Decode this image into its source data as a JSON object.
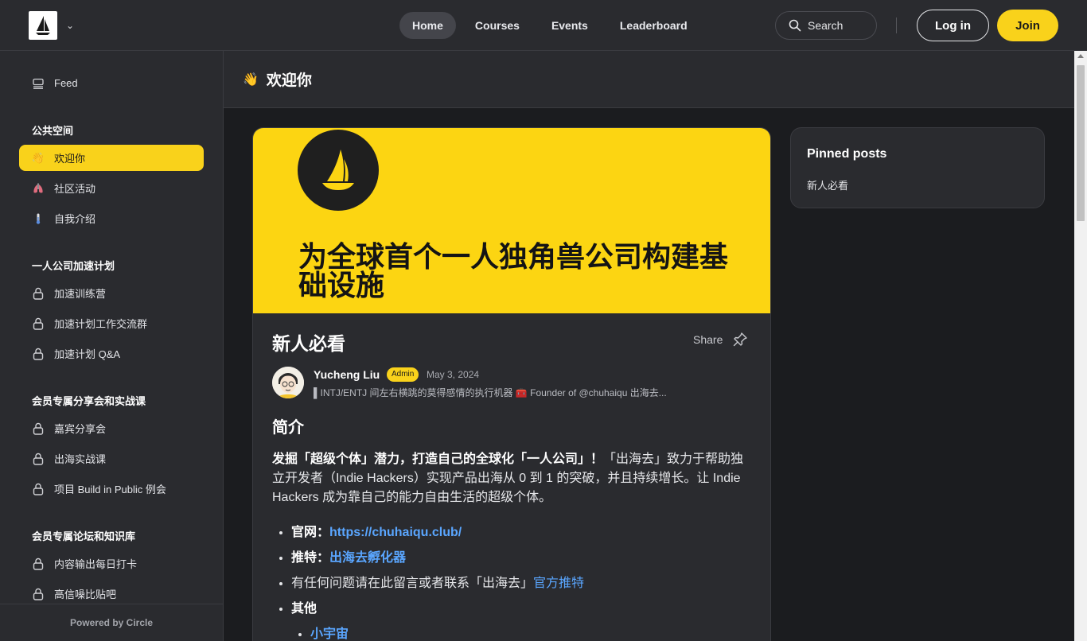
{
  "header": {
    "nav": [
      {
        "label": "Home",
        "active": true
      },
      {
        "label": "Courses",
        "active": false
      },
      {
        "label": "Events",
        "active": false
      },
      {
        "label": "Leaderboard",
        "active": false
      }
    ],
    "search_label": "Search",
    "login_label": "Log in",
    "join_label": "Join",
    "accent_color": "#f9d21b"
  },
  "sidebar": {
    "feed_label": "Feed",
    "groups": [
      {
        "heading": "公共空间",
        "items": [
          {
            "label": "欢迎你",
            "icon": "waving-hand-icon",
            "active": true
          },
          {
            "label": "社区活动",
            "icon": "lungs-icon",
            "active": false
          },
          {
            "label": "自我介绍",
            "icon": "thermometer-icon",
            "active": false
          }
        ]
      },
      {
        "heading": "一人公司加速计划",
        "items": [
          {
            "label": "加速训练营",
            "icon": "lock-icon"
          },
          {
            "label": "加速计划工作交流群",
            "icon": "lock-icon"
          },
          {
            "label": "加速计划 Q&A",
            "icon": "lock-icon"
          }
        ]
      },
      {
        "heading": "会员专属分享会和实战课",
        "items": [
          {
            "label": "嘉宾分享会",
            "icon": "lock-icon"
          },
          {
            "label": "出海实战课",
            "icon": "lock-icon"
          },
          {
            "label": "项目 Build in Public 例会",
            "icon": "lock-icon"
          }
        ]
      },
      {
        "heading": "会员专属论坛和知识库",
        "items": [
          {
            "label": "内容输出每日打卡",
            "icon": "lock-icon"
          },
          {
            "label": "高信噪比贴吧",
            "icon": "lock-icon"
          }
        ]
      }
    ],
    "footer": "Powered by Circle"
  },
  "page": {
    "title": "欢迎你"
  },
  "post": {
    "cover_text": "为全球首个一人独角兽公司构建基础设施",
    "title": "新人必看",
    "share_label": "Share",
    "author": {
      "name": "Yucheng Liu",
      "badge": "Admin",
      "date": "May 3, 2024",
      "bio": "▌INTJ/ENTJ 间左右横跳的莫得感情的执行机器 🧰 Founder of @chuhaiqu 出海去..."
    },
    "intro_heading": "简介",
    "intro_bold": "发掘「超级个体」潜力，打造自己的全球化「一人公司」！",
    "intro_rest": "「出海去」致力于帮助独立开发者（Indie Hackers）实现产品出海从 0 到 1 的突破，并且持续增长。让 Indie Hackers 成为靠自己的能力自由生活的超级个体。",
    "list": {
      "site_label": "官网：",
      "site_link": "https://chuhaiqu.club/",
      "twitter_label": "推特：",
      "twitter_link": "出海去孵化器",
      "contact_text": "有任何问题请在此留言或者联系「出海去」",
      "contact_link": "官方推特",
      "other_label": "其他",
      "sub_link": "小宇宙"
    }
  },
  "pinned": {
    "title": "Pinned posts",
    "items": [
      "新人必看"
    ]
  }
}
